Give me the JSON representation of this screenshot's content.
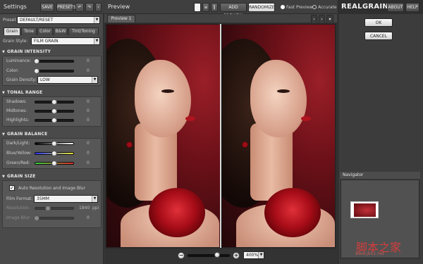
{
  "left_panel": {
    "title": "Settings",
    "save_label": "SAVE",
    "presets_label": "PRESETS",
    "undo_icon": "undo-icon",
    "redo_icon": "redo-icon",
    "preset_label": "Preset",
    "preset_value": "DEFAULT/RESET",
    "tabs": [
      {
        "label": "Grain",
        "active": true
      },
      {
        "label": "Tone",
        "active": false
      },
      {
        "label": "Color",
        "active": false
      },
      {
        "label": "B&W",
        "active": false
      },
      {
        "label": "Tint/Toning",
        "active": false
      }
    ],
    "grain_style_label": "Grain Style:",
    "grain_style_value": "FILM GRAIN",
    "grain_intensity": {
      "header": "GRAIN INTENSITY",
      "luminance_label": "Luminance:",
      "luminance_value": "0",
      "luminance_level": 0,
      "color_label": "Color:",
      "color_value": "0",
      "color_level": 0,
      "density_label": "Grain Density:",
      "density_value": "LOW"
    },
    "tonal_range": {
      "header": "TONAL RANGE",
      "shadows_label": "Shadows:",
      "shadows_value": "0",
      "midtones_label": "Midtones:",
      "midtones_value": "0",
      "highlights_label": "Highlights:",
      "highlights_value": "0"
    },
    "grain_balance": {
      "header": "GRAIN BALANCE",
      "dark_light_label": "Dark/Light:",
      "dark_light_value": "0",
      "blue_yellow_label": "Blue/Yellow:",
      "blue_yellow_value": "0",
      "green_red_label": "Green/Red:",
      "green_red_value": "0"
    },
    "grain_size": {
      "header": "GRAIN SIZE",
      "auto_label": "Auto Resolution and Image Blur",
      "auto_checked": true,
      "film_format_label": "Film Format:",
      "film_format_value": "35MM",
      "resolution_label": "Resolution:",
      "resolution_value": "1840",
      "resolution_unit": "ppi",
      "image_blur_label": "Image Blur:",
      "image_blur_value": "0"
    }
  },
  "center_panel": {
    "title": "Preview",
    "add_preview_label": "ADD PREVIEW",
    "randomize_label": "RANDOMIZE",
    "fast_preview_label": "Fast Preview",
    "accurate_label": "Accurate",
    "preview_mode": "Fast Preview",
    "preview_tab_label": "Preview 1",
    "zoom_value": "400%"
  },
  "right_panel": {
    "logo": "REALGRAIN 2",
    "about_label": "ABOUT",
    "help_label": "HELP",
    "ok_label": "OK",
    "cancel_label": "CANCEL",
    "navigator_label": "Navigator"
  },
  "watermark": {
    "text": "脚本之家",
    "sub": "www.jb51.net"
  },
  "colors": {
    "panel": "#4a4a4a",
    "accent": "#ffffff",
    "photo_red": "#8e1a22"
  }
}
